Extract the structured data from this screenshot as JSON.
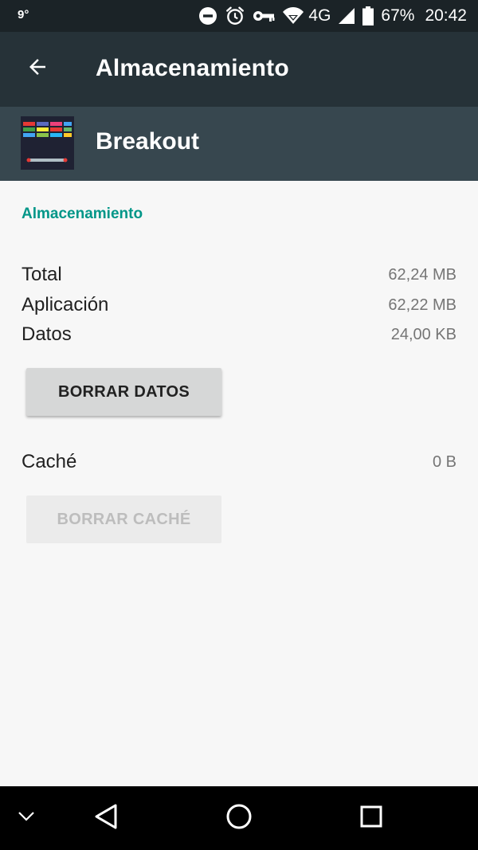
{
  "status_bar": {
    "temperature": "9°",
    "network": "4G",
    "battery": "67%",
    "time": "20:42",
    "icons": [
      "do-not-disturb-icon",
      "alarm-icon",
      "vpn-key-icon",
      "wifi-icon",
      "signal-icon",
      "battery-icon"
    ]
  },
  "toolbar": {
    "title": "Almacenamiento",
    "back_icon": "arrow-back-icon"
  },
  "app": {
    "name": "Breakout",
    "icon": "breakout-app-icon"
  },
  "storage": {
    "section_title": "Almacenamiento",
    "rows": [
      {
        "label": "Total",
        "value": "62,24 MB"
      },
      {
        "label": "Aplicación",
        "value": "62,22 MB"
      },
      {
        "label": "Datos",
        "value": "24,00 KB"
      }
    ],
    "clear_data_label": "BORRAR DATOS",
    "cache": {
      "label": "Caché",
      "value": "0 B"
    },
    "clear_cache_label": "BORRAR CACHÉ"
  },
  "nav_bar": {
    "icons": [
      "chevron-down-icon",
      "back-icon",
      "home-icon",
      "recents-icon"
    ]
  },
  "colors": {
    "status_bar": "#1b2327",
    "toolbar": "#263238",
    "app_header": "#37474f",
    "accent": "#009688",
    "background": "#f7f7f7"
  }
}
